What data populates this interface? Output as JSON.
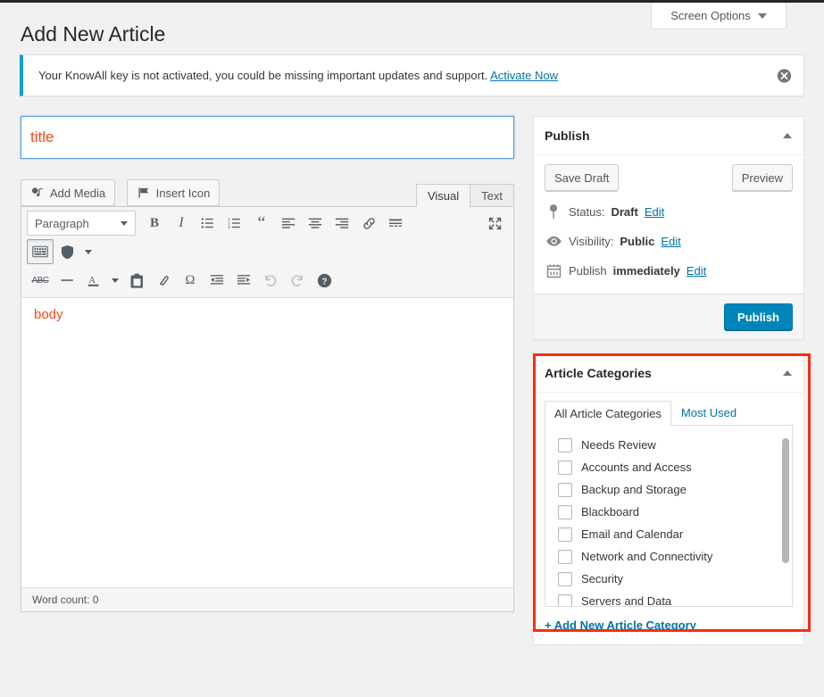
{
  "header": {
    "page_title": "Add New Article",
    "screen_options_label": "Screen Options"
  },
  "notice": {
    "text": "Your KnowAll key is not activated, you could be missing important updates and support.",
    "link_label": "Activate Now",
    "accent_color": "#00a0d2",
    "dismiss_icon": "close-circle-icon"
  },
  "editor": {
    "title_placeholder": "title",
    "title_value": "",
    "title_text_color": "#fa4616",
    "add_media_label": "Add Media",
    "insert_icon_label": "Insert Icon",
    "tabs": [
      {
        "label": "Visual",
        "active": true
      },
      {
        "label": "Text",
        "active": false
      }
    ],
    "format_select": "Paragraph",
    "toolbar_row1": [
      "bold-icon",
      "italic-icon",
      "bulleted-list-icon",
      "numbered-list-icon",
      "blockquote-icon",
      "align-left-icon",
      "align-center-icon",
      "align-right-icon",
      "insert-link-icon",
      "read-more-icon",
      "fullscreen-icon"
    ],
    "toolbar_row2": [
      "keyboard-toolbar-toggle-icon",
      "shield-icon",
      "chevron-down-icon"
    ],
    "toolbar_row3": [
      "strikethrough-icon",
      "horizontal-rule-icon",
      "text-color-icon",
      "chevron-down-icon",
      "paste-as-text-icon",
      "clear-formatting-icon",
      "special-character-icon",
      "outdent-icon",
      "indent-icon",
      "undo-icon",
      "redo-icon",
      "keyboard-shortcuts-help-icon"
    ],
    "body_text": "body",
    "word_count_label": "Word count: 0"
  },
  "publish_box": {
    "title": "Publish",
    "toggle_icon": "chevron-up-icon",
    "save_draft_label": "Save Draft",
    "preview_label": "Preview",
    "status": {
      "icon": "pin-icon",
      "label": "Status:",
      "value": "Draft",
      "edit_label": "Edit"
    },
    "visibility": {
      "icon": "eye-icon",
      "label": "Visibility:",
      "value": "Public",
      "edit_label": "Edit"
    },
    "schedule": {
      "icon": "calendar-icon",
      "label": "Publish",
      "value": "immediately",
      "edit_label": "Edit"
    },
    "publish_label": "Publish",
    "publish_color": "#0085ba"
  },
  "categories_box": {
    "title": "Article Categories",
    "toggle_icon": "chevron-up-icon",
    "highlight_color": "#fb2b14",
    "tabs": [
      {
        "label": "All Article Categories",
        "active": true
      },
      {
        "label": "Most Used",
        "active": false
      }
    ],
    "items": [
      {
        "label": "Needs Review",
        "checked": false
      },
      {
        "label": "Accounts and Access",
        "checked": false
      },
      {
        "label": "Backup and Storage",
        "checked": false
      },
      {
        "label": "Blackboard",
        "checked": false
      },
      {
        "label": "Email and Calendar",
        "checked": false
      },
      {
        "label": "Network and Connectivity",
        "checked": false
      },
      {
        "label": "Security",
        "checked": false
      },
      {
        "label": "Servers and Data",
        "checked": false
      }
    ],
    "add_new_label": "+ Add New Article Category"
  }
}
